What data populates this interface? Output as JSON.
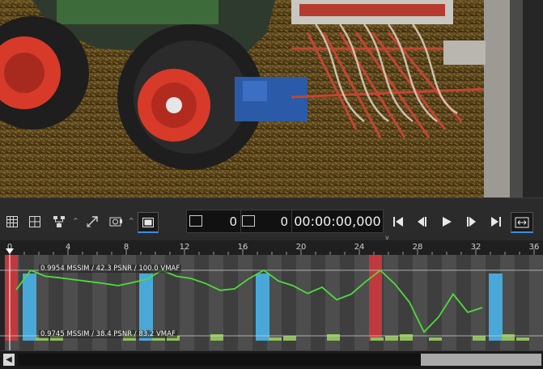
{
  "video": {
    "description_icon": "video-frame"
  },
  "toolbar": {
    "buttons": [
      {
        "name": "grid-small-icon"
      },
      {
        "name": "grid-large-icon"
      },
      {
        "name": "network-icon"
      },
      {
        "name": "arrow-diagonal-icon"
      },
      {
        "name": "camera-settings-icon"
      },
      {
        "name": "display-mode-icon"
      }
    ],
    "frame_start_value": "0",
    "frame_end_value": "0",
    "timecode": "00:00:00,000",
    "transport": [
      {
        "name": "skip-to-start-icon"
      },
      {
        "name": "step-back-icon"
      },
      {
        "name": "play-icon"
      },
      {
        "name": "step-forward-icon"
      },
      {
        "name": "skip-to-end-icon"
      },
      {
        "name": "fit-width-icon"
      }
    ]
  },
  "timeline": {
    "ticks": [
      "0",
      "4",
      "8",
      "12",
      "16",
      "20",
      "24",
      "28",
      "32",
      "36"
    ],
    "tick_values": [
      0,
      4,
      8,
      12,
      16,
      20,
      24,
      28,
      32,
      36
    ],
    "top_metric_label": "0.9954 MSSIM / 42.3 PSNR / 100.0 VMAF",
    "bottom_metric_label": "0.9745 MSSIM / 38.4 PSNR / 83.2 VMAF",
    "colors": {
      "line": "#4cdc3a",
      "blue_bar": "#4aa8d8",
      "red_bar": "#c0393e",
      "green_bar": "#8fbf5a",
      "stripe_a": "#4d4d4d",
      "stripe_b": "#3e3e3e"
    }
  },
  "chart_data": {
    "type": "line",
    "x": [
      0,
      1,
      2,
      3,
      4,
      5,
      6,
      7,
      8,
      9,
      10,
      11,
      12,
      13,
      14,
      15,
      16,
      17,
      18,
      19,
      20,
      21,
      22,
      23,
      24,
      25,
      26,
      27,
      28,
      29,
      30,
      31,
      32
    ],
    "series": [
      {
        "values": [
          0.9892,
          0.9954,
          0.9935,
          0.993,
          0.9924,
          0.9918,
          0.9912,
          0.9905,
          0.9915,
          0.9926,
          0.9954,
          0.9935,
          0.9928,
          0.9912,
          0.989,
          0.9895,
          0.9928,
          0.9954,
          0.992,
          0.9905,
          0.988,
          0.99,
          0.986,
          0.9878,
          0.9918,
          0.9954,
          0.991,
          0.9852,
          0.9757,
          0.9805,
          0.9878,
          0.982,
          0.9835
        ]
      }
    ],
    "bars": {
      "blue_frames": [
        1,
        9,
        17,
        33
      ],
      "red_frames": [
        0,
        25
      ],
      "green_frames": [
        2,
        3,
        8,
        10,
        11,
        14,
        18,
        19,
        22,
        25,
        26,
        27,
        29,
        32,
        34,
        35
      ]
    },
    "ylim": [
      0.9745,
      0.9954
    ],
    "xlim": [
      0,
      36
    ]
  },
  "scrollbar": {
    "left_arrow": "◀",
    "thumb_start": 0.77,
    "thumb_end": 1.0
  }
}
